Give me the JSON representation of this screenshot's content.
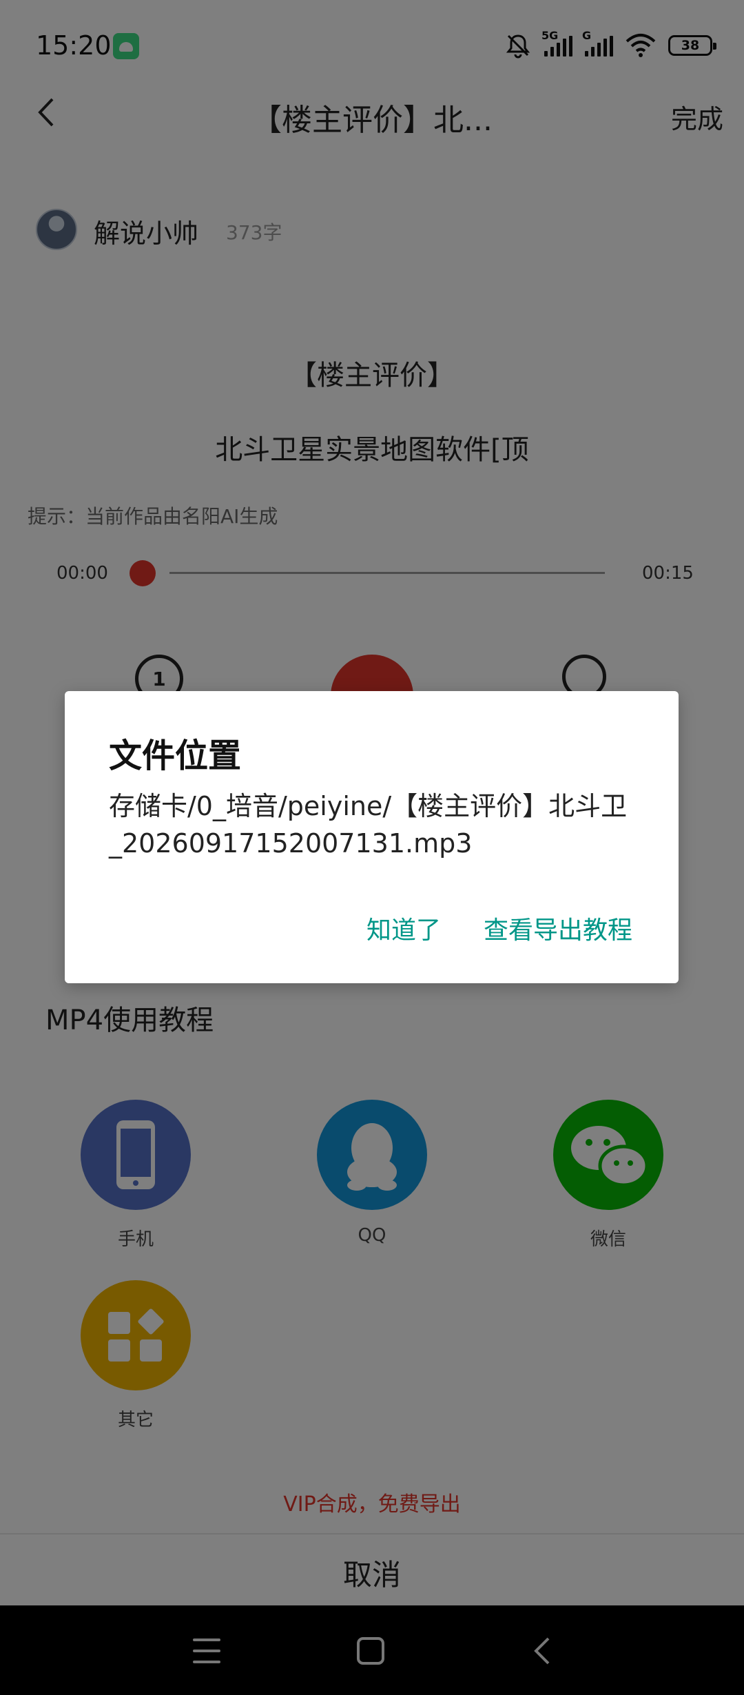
{
  "status_bar": {
    "time": "15:20",
    "network_labels": [
      "5G",
      "G"
    ],
    "battery": "38"
  },
  "header": {
    "title": "【楼主评价】北...",
    "done_label": "完成"
  },
  "author": {
    "name": "解说小帅",
    "word_count": "373字"
  },
  "content": {
    "heading": "【楼主评价】",
    "subheading": "北斗卫星实景地图软件[顶",
    "hint": "提示：当前作品由名阳AI生成"
  },
  "player": {
    "current_time": "00:00",
    "total_time": "00:15",
    "progress": 0,
    "replay_label": "1"
  },
  "section": {
    "mp4_tutorial": "MP4使用教程"
  },
  "share_sheet": {
    "targets": [
      {
        "label": "手机",
        "icon": "phone-icon",
        "color": "#5470c6"
      },
      {
        "label": "QQ",
        "icon": "qq-icon",
        "color": "#1296db"
      },
      {
        "label": "微信",
        "icon": "wechat-icon",
        "color": "#09bb07"
      },
      {
        "label": "其它",
        "icon": "apps-icon",
        "color": "#f0b400"
      }
    ],
    "vip_text": "VIP合成，免费导出",
    "cancel_label": "取消"
  },
  "dialog": {
    "title": "文件位置",
    "message": "存储卡/0_培音/peiyine/【楼主评价】北斗卫_20260917152007131.mp3",
    "ok_label": "知道了",
    "tutorial_label": "查看导出教程"
  },
  "colors": {
    "accent": "#009688",
    "play_red": "#e0352b",
    "vip_red": "#e0352b"
  }
}
